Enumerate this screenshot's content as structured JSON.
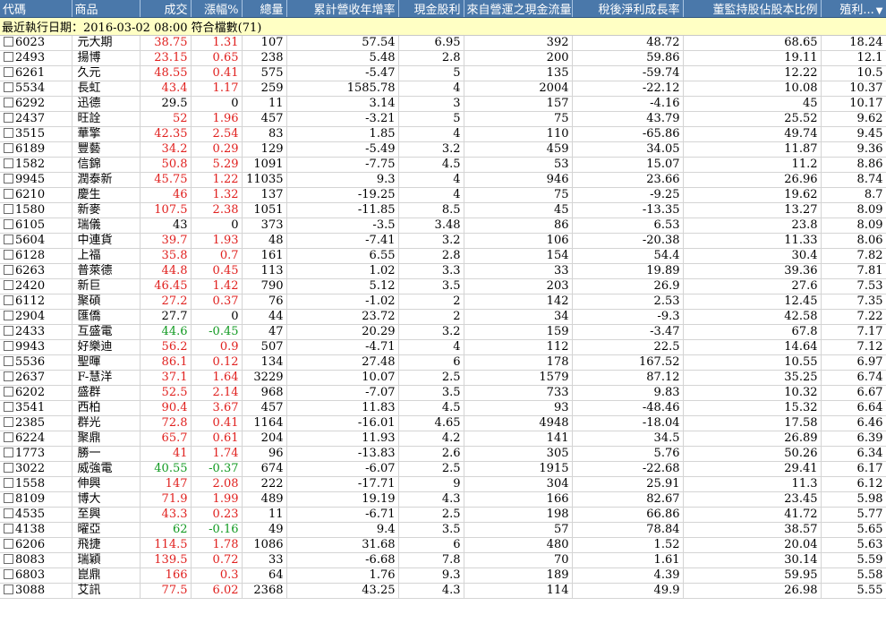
{
  "headers": [
    "代碼",
    "商品",
    "成交",
    "漲幅%",
    "總量",
    "累計營收年增率",
    "現金股利",
    "來自營運之現金流量",
    "稅後淨利成長率",
    "董監持股佔股本比例",
    "殖利..."
  ],
  "info": "最近執行日期：2016-03-02 08:00 符合檔數(71)",
  "sort_indicator": "▼",
  "colors": {
    "header_bg": "#4a78aa",
    "info_bg": "#ffffc4",
    "up": "#e0201e",
    "down": "#129a22"
  },
  "rows": [
    {
      "code": "6023",
      "name": "元大期",
      "price": "38.75",
      "change": "1.31",
      "volume": "107",
      "revenue_yoy": "57.54",
      "cash_dividend": "6.95",
      "op_cash_flow": "392",
      "net_income_growth": "48.72",
      "director_holding": "68.65",
      "yield": "18.24",
      "dir": "up"
    },
    {
      "code": "2493",
      "name": "揚博",
      "price": "23.15",
      "change": "0.65",
      "volume": "238",
      "revenue_yoy": "5.48",
      "cash_dividend": "2.8",
      "op_cash_flow": "200",
      "net_income_growth": "59.86",
      "director_holding": "19.11",
      "yield": "12.1",
      "dir": "up"
    },
    {
      "code": "6261",
      "name": "久元",
      "price": "48.55",
      "change": "0.41",
      "volume": "575",
      "revenue_yoy": "-5.47",
      "cash_dividend": "5",
      "op_cash_flow": "135",
      "net_income_growth": "-59.74",
      "director_holding": "12.22",
      "yield": "10.5",
      "dir": "up"
    },
    {
      "code": "5534",
      "name": "長虹",
      "price": "43.4",
      "change": "1.17",
      "volume": "259",
      "revenue_yoy": "1585.78",
      "cash_dividend": "4",
      "op_cash_flow": "2004",
      "net_income_growth": "-22.12",
      "director_holding": "10.08",
      "yield": "10.37",
      "dir": "up"
    },
    {
      "code": "6292",
      "name": "迅德",
      "price": "29.5",
      "change": "0",
      "volume": "11",
      "revenue_yoy": "3.14",
      "cash_dividend": "3",
      "op_cash_flow": "157",
      "net_income_growth": "-4.16",
      "director_holding": "45",
      "yield": "10.17",
      "dir": "flat"
    },
    {
      "code": "2437",
      "name": "旺詮",
      "price": "52",
      "change": "1.96",
      "volume": "457",
      "revenue_yoy": "-3.21",
      "cash_dividend": "5",
      "op_cash_flow": "75",
      "net_income_growth": "43.79",
      "director_holding": "25.52",
      "yield": "9.62",
      "dir": "up"
    },
    {
      "code": "3515",
      "name": "華擎",
      "price": "42.35",
      "change": "2.54",
      "volume": "83",
      "revenue_yoy": "1.85",
      "cash_dividend": "4",
      "op_cash_flow": "110",
      "net_income_growth": "-65.86",
      "director_holding": "49.74",
      "yield": "9.45",
      "dir": "up"
    },
    {
      "code": "6189",
      "name": "豐藝",
      "price": "34.2",
      "change": "0.29",
      "volume": "129",
      "revenue_yoy": "-5.49",
      "cash_dividend": "3.2",
      "op_cash_flow": "459",
      "net_income_growth": "34.05",
      "director_holding": "11.87",
      "yield": "9.36",
      "dir": "up"
    },
    {
      "code": "1582",
      "name": "信錦",
      "price": "50.8",
      "change": "5.29",
      "volume": "1091",
      "revenue_yoy": "-7.75",
      "cash_dividend": "4.5",
      "op_cash_flow": "53",
      "net_income_growth": "15.07",
      "director_holding": "11.2",
      "yield": "8.86",
      "dir": "up"
    },
    {
      "code": "9945",
      "name": "潤泰新",
      "price": "45.75",
      "change": "1.22",
      "volume": "11035",
      "revenue_yoy": "9.3",
      "cash_dividend": "4",
      "op_cash_flow": "946",
      "net_income_growth": "23.66",
      "director_holding": "26.96",
      "yield": "8.74",
      "dir": "up"
    },
    {
      "code": "6210",
      "name": "慶生",
      "price": "46",
      "change": "1.32",
      "volume": "137",
      "revenue_yoy": "-19.25",
      "cash_dividend": "4",
      "op_cash_flow": "75",
      "net_income_growth": "-9.25",
      "director_holding": "19.62",
      "yield": "8.7",
      "dir": "up"
    },
    {
      "code": "1580",
      "name": "新麥",
      "price": "107.5",
      "change": "2.38",
      "volume": "1051",
      "revenue_yoy": "-11.85",
      "cash_dividend": "8.5",
      "op_cash_flow": "45",
      "net_income_growth": "-13.35",
      "director_holding": "13.27",
      "yield": "8.09",
      "dir": "up"
    },
    {
      "code": "6105",
      "name": "瑞儀",
      "price": "43",
      "change": "0",
      "volume": "373",
      "revenue_yoy": "-3.5",
      "cash_dividend": "3.48",
      "op_cash_flow": "86",
      "net_income_growth": "6.53",
      "director_holding": "23.8",
      "yield": "8.09",
      "dir": "flat"
    },
    {
      "code": "5604",
      "name": "中連貨",
      "price": "39.7",
      "change": "1.93",
      "volume": "48",
      "revenue_yoy": "-7.41",
      "cash_dividend": "3.2",
      "op_cash_flow": "106",
      "net_income_growth": "-20.38",
      "director_holding": "11.33",
      "yield": "8.06",
      "dir": "up"
    },
    {
      "code": "6128",
      "name": "上福",
      "price": "35.8",
      "change": "0.7",
      "volume": "161",
      "revenue_yoy": "6.55",
      "cash_dividend": "2.8",
      "op_cash_flow": "154",
      "net_income_growth": "54.4",
      "director_holding": "30.4",
      "yield": "7.82",
      "dir": "up"
    },
    {
      "code": "6263",
      "name": "普萊德",
      "price": "44.8",
      "change": "0.45",
      "volume": "113",
      "revenue_yoy": "1.02",
      "cash_dividend": "3.3",
      "op_cash_flow": "33",
      "net_income_growth": "19.89",
      "director_holding": "39.36",
      "yield": "7.81",
      "dir": "up"
    },
    {
      "code": "2420",
      "name": "新巨",
      "price": "46.45",
      "change": "1.42",
      "volume": "790",
      "revenue_yoy": "5.12",
      "cash_dividend": "3.5",
      "op_cash_flow": "203",
      "net_income_growth": "26.9",
      "director_holding": "27.6",
      "yield": "7.53",
      "dir": "up"
    },
    {
      "code": "6112",
      "name": "聚碩",
      "price": "27.2",
      "change": "0.37",
      "volume": "76",
      "revenue_yoy": "-1.02",
      "cash_dividend": "2",
      "op_cash_flow": "142",
      "net_income_growth": "2.53",
      "director_holding": "12.45",
      "yield": "7.35",
      "dir": "up"
    },
    {
      "code": "2904",
      "name": "匯僑",
      "price": "27.7",
      "change": "0",
      "volume": "44",
      "revenue_yoy": "23.72",
      "cash_dividend": "2",
      "op_cash_flow": "34",
      "net_income_growth": "-9.3",
      "director_holding": "42.58",
      "yield": "7.22",
      "dir": "flat"
    },
    {
      "code": "2433",
      "name": "互盛電",
      "price": "44.6",
      "change": "-0.45",
      "volume": "47",
      "revenue_yoy": "20.29",
      "cash_dividend": "3.2",
      "op_cash_flow": "159",
      "net_income_growth": "-3.47",
      "director_holding": "67.8",
      "yield": "7.17",
      "dir": "down"
    },
    {
      "code": "9943",
      "name": "好樂迪",
      "price": "56.2",
      "change": "0.9",
      "volume": "507",
      "revenue_yoy": "-4.71",
      "cash_dividend": "4",
      "op_cash_flow": "112",
      "net_income_growth": "22.5",
      "director_holding": "14.64",
      "yield": "7.12",
      "dir": "up"
    },
    {
      "code": "5536",
      "name": "聖暉",
      "price": "86.1",
      "change": "0.12",
      "volume": "134",
      "revenue_yoy": "27.48",
      "cash_dividend": "6",
      "op_cash_flow": "178",
      "net_income_growth": "167.52",
      "director_holding": "10.55",
      "yield": "6.97",
      "dir": "up"
    },
    {
      "code": "2637",
      "name": "F-慧洋",
      "price": "37.1",
      "change": "1.64",
      "volume": "3229",
      "revenue_yoy": "10.07",
      "cash_dividend": "2.5",
      "op_cash_flow": "1579",
      "net_income_growth": "87.12",
      "director_holding": "35.25",
      "yield": "6.74",
      "dir": "up"
    },
    {
      "code": "6202",
      "name": "盛群",
      "price": "52.5",
      "change": "2.14",
      "volume": "968",
      "revenue_yoy": "-7.07",
      "cash_dividend": "3.5",
      "op_cash_flow": "733",
      "net_income_growth": "9.83",
      "director_holding": "10.32",
      "yield": "6.67",
      "dir": "up"
    },
    {
      "code": "3541",
      "name": "西柏",
      "price": "90.4",
      "change": "3.67",
      "volume": "457",
      "revenue_yoy": "11.83",
      "cash_dividend": "4.5",
      "op_cash_flow": "93",
      "net_income_growth": "-48.46",
      "director_holding": "15.32",
      "yield": "6.64",
      "dir": "up"
    },
    {
      "code": "2385",
      "name": "群光",
      "price": "72.8",
      "change": "0.41",
      "volume": "1164",
      "revenue_yoy": "-16.01",
      "cash_dividend": "4.65",
      "op_cash_flow": "4948",
      "net_income_growth": "-18.04",
      "director_holding": "17.58",
      "yield": "6.46",
      "dir": "up"
    },
    {
      "code": "6224",
      "name": "聚鼎",
      "price": "65.7",
      "change": "0.61",
      "volume": "204",
      "revenue_yoy": "11.93",
      "cash_dividend": "4.2",
      "op_cash_flow": "141",
      "net_income_growth": "34.5",
      "director_holding": "26.89",
      "yield": "6.39",
      "dir": "up"
    },
    {
      "code": "1773",
      "name": "勝一",
      "price": "41",
      "change": "1.74",
      "volume": "96",
      "revenue_yoy": "-13.83",
      "cash_dividend": "2.6",
      "op_cash_flow": "305",
      "net_income_growth": "5.76",
      "director_holding": "50.26",
      "yield": "6.34",
      "dir": "up"
    },
    {
      "code": "3022",
      "name": "威強電",
      "price": "40.55",
      "change": "-0.37",
      "volume": "674",
      "revenue_yoy": "-6.07",
      "cash_dividend": "2.5",
      "op_cash_flow": "1915",
      "net_income_growth": "-22.68",
      "director_holding": "29.41",
      "yield": "6.17",
      "dir": "down"
    },
    {
      "code": "1558",
      "name": "伸興",
      "price": "147",
      "change": "2.08",
      "volume": "222",
      "revenue_yoy": "-17.71",
      "cash_dividend": "9",
      "op_cash_flow": "304",
      "net_income_growth": "25.91",
      "director_holding": "11.3",
      "yield": "6.12",
      "dir": "up"
    },
    {
      "code": "8109",
      "name": "博大",
      "price": "71.9",
      "change": "1.99",
      "volume": "489",
      "revenue_yoy": "19.19",
      "cash_dividend": "4.3",
      "op_cash_flow": "166",
      "net_income_growth": "82.67",
      "director_holding": "23.45",
      "yield": "5.98",
      "dir": "up"
    },
    {
      "code": "4535",
      "name": "至興",
      "price": "43.3",
      "change": "0.23",
      "volume": "11",
      "revenue_yoy": "-6.71",
      "cash_dividend": "2.5",
      "op_cash_flow": "198",
      "net_income_growth": "66.86",
      "director_holding": "41.72",
      "yield": "5.77",
      "dir": "up"
    },
    {
      "code": "4138",
      "name": "曜亞",
      "price": "62",
      "change": "-0.16",
      "volume": "49",
      "revenue_yoy": "9.4",
      "cash_dividend": "3.5",
      "op_cash_flow": "57",
      "net_income_growth": "78.84",
      "director_holding": "38.57",
      "yield": "5.65",
      "dir": "down"
    },
    {
      "code": "6206",
      "name": "飛捷",
      "price": "114.5",
      "change": "1.78",
      "volume": "1086",
      "revenue_yoy": "31.68",
      "cash_dividend": "6",
      "op_cash_flow": "480",
      "net_income_growth": "1.52",
      "director_holding": "20.04",
      "yield": "5.63",
      "dir": "up"
    },
    {
      "code": "8083",
      "name": "瑞穎",
      "price": "139.5",
      "change": "0.72",
      "volume": "33",
      "revenue_yoy": "-6.68",
      "cash_dividend": "7.8",
      "op_cash_flow": "70",
      "net_income_growth": "1.61",
      "director_holding": "30.14",
      "yield": "5.59",
      "dir": "up"
    },
    {
      "code": "6803",
      "name": "崑鼎",
      "price": "166",
      "change": "0.3",
      "volume": "64",
      "revenue_yoy": "1.76",
      "cash_dividend": "9.3",
      "op_cash_flow": "189",
      "net_income_growth": "4.39",
      "director_holding": "59.95",
      "yield": "5.58",
      "dir": "up"
    },
    {
      "code": "3088",
      "name": "艾訊",
      "price": "77.5",
      "change": "6.02",
      "volume": "2368",
      "revenue_yoy": "43.25",
      "cash_dividend": "4.3",
      "op_cash_flow": "114",
      "net_income_growth": "49.9",
      "director_holding": "26.98",
      "yield": "5.55",
      "dir": "up"
    }
  ]
}
